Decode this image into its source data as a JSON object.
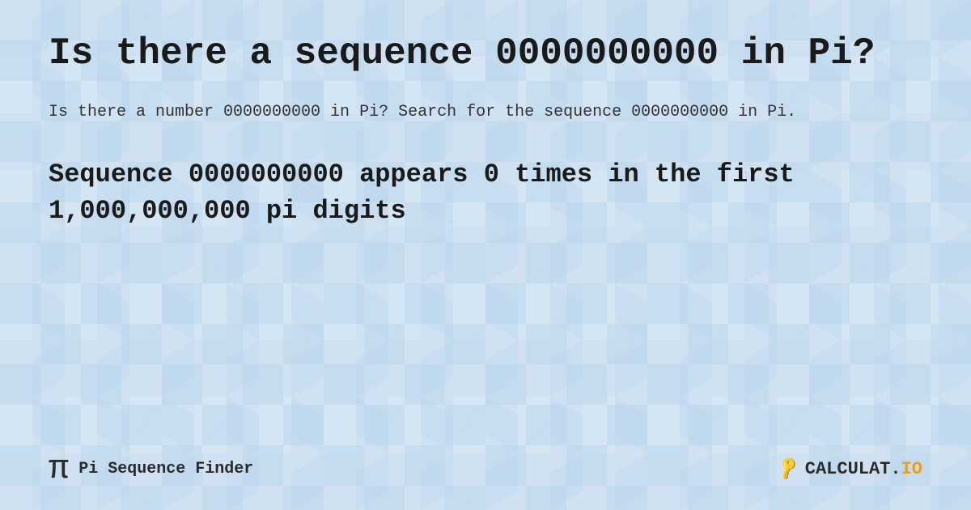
{
  "page": {
    "title": "Is there a sequence 0000000000 in Pi?",
    "description": "Is there a number 0000000000 in Pi? Search for the sequence 0000000000 in Pi.",
    "result": {
      "text": "Sequence 0000000000 appears 0 times in the first 1,000,000,000 pi digits"
    },
    "footer": {
      "pi_symbol": "π",
      "site_name": "Pi Sequence Finder",
      "logo_text": "CALCULAT.IO"
    }
  }
}
